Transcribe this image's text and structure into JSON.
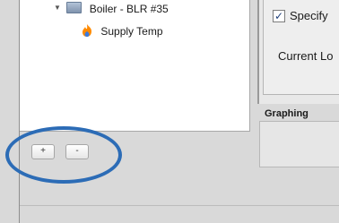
{
  "tree": {
    "items": [
      {
        "label": "Boiler - BLR #35",
        "icon": "folder-icon",
        "expanded": true
      },
      {
        "label": "Supply Temp",
        "icon": "flame-icon"
      }
    ]
  },
  "tree_buttons": {
    "add_label": "+",
    "remove_label": "-"
  },
  "properties": {
    "specify_label": "Specify",
    "specify_checked_glyph": "✓",
    "current_label": "Current Lo"
  },
  "graphing": {
    "title": "Graphing"
  },
  "colors": {
    "annotation": "#2c6cb6",
    "flame_orange": "#ff8a00",
    "flame_blue": "#3b7be0"
  }
}
